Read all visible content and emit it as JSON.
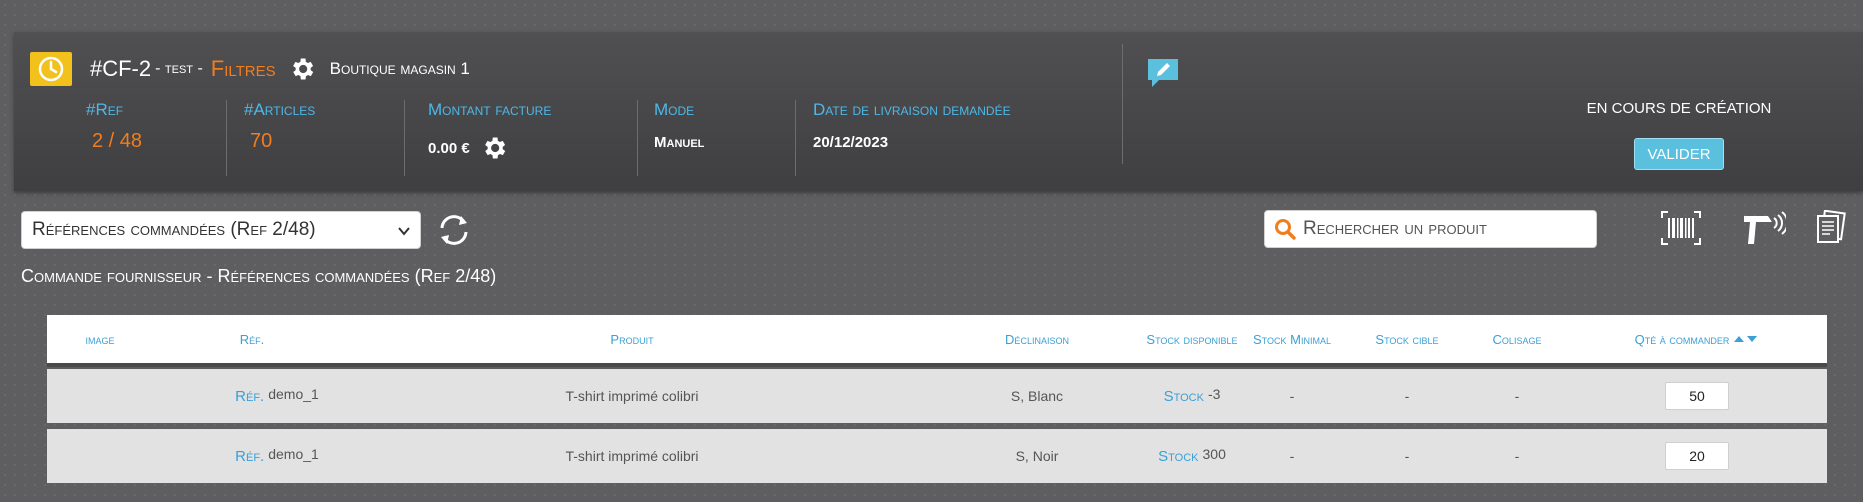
{
  "header": {
    "order_id": "#CF-2",
    "order_test": "- test -",
    "filters_label": "Filtres",
    "shop_name": "Boutique magasin 1",
    "status_text": "EN COURS DE CRÉATION",
    "validate_label": "VALIDER",
    "stats": {
      "ref_label": "#Ref",
      "ref_value": "2 / 48",
      "articles_label": "#Articles",
      "articles_value": "70",
      "invoice_label": "Montant facture",
      "invoice_value": "0.00 €",
      "mode_label": "Mode",
      "mode_value": "Manuel",
      "delivery_label": "Date de livraison demandée",
      "delivery_value": "20/12/2023"
    }
  },
  "toolbar": {
    "select_value": "Références commandées (Ref 2/48)",
    "search_placeholder": "Rechercher un produit"
  },
  "section_title": "Commande fournisseur - Références commandées (Ref 2/48)",
  "table": {
    "headers": {
      "image": "image",
      "ref": "Réf.",
      "product": "Produit",
      "variant": "Déclinaison",
      "stock_available": "Stock disponible",
      "stock_min": "Stock Minimal",
      "stock_target": "Stock cible",
      "packaging": "Colisage",
      "qty": "Qté à commander"
    },
    "rows": [
      {
        "ref_label": "Réf.",
        "ref": "demo_1",
        "product": "T-shirt imprimé colibri",
        "variant": "S, Blanc",
        "stock_label": "Stock",
        "stock": "-3",
        "stock_min": "-",
        "stock_target": "-",
        "packaging": "-",
        "qty": "50"
      },
      {
        "ref_label": "Réf.",
        "ref": "demo_1",
        "product": "T-shirt imprimé colibri",
        "variant": "S, Noir",
        "stock_label": "Stock",
        "stock": "300",
        "stock_min": "-",
        "stock_target": "-",
        "packaging": "-",
        "qty": "20"
      }
    ]
  },
  "colors": {
    "accent_blue": "#4db8e8",
    "accent_orange": "#f07d1e",
    "badge_yellow": "#f2c11b",
    "button_blue": "#5bc0de"
  },
  "icons": [
    "clock-icon",
    "gear-icon",
    "edit-note-icon",
    "refresh-icon",
    "search-icon",
    "barcode-icon",
    "scanner-icon",
    "documents-icon",
    "sort-arrows-icon"
  ]
}
